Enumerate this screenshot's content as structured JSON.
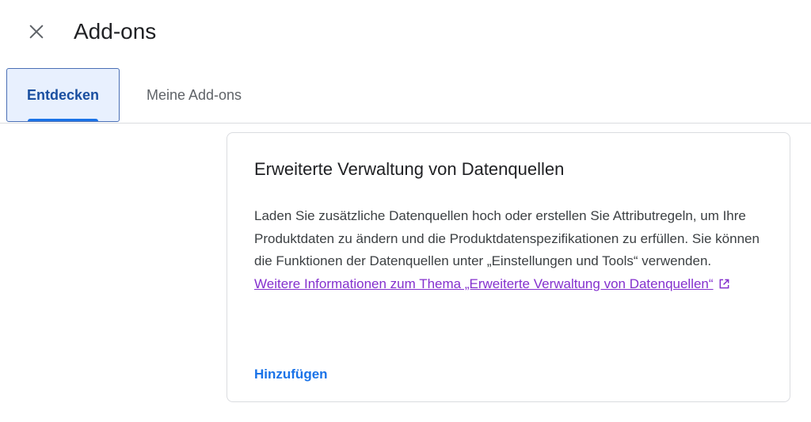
{
  "header": {
    "title": "Add-ons",
    "close_icon": "close-icon"
  },
  "tabs": [
    {
      "label": "Entdecken",
      "selected": true
    },
    {
      "label": "Meine Add-ons",
      "selected": false
    }
  ],
  "card": {
    "title": "Erweiterte Verwaltung von Datenquellen",
    "description": "Laden Sie zusätzliche Datenquellen hoch oder erstellen Sie Attributregeln, um Ihre Produktdaten zu ändern und die Produktdatenspezifikationen zu erfüllen. Sie können die Funktionen der Datenquellen unter „Einstellungen und Tools“ verwenden. ",
    "link_text": "Weitere Informationen zum Thema „Erweiterte Verwaltung von Datenquellen“",
    "link_icon": "open-in-new-icon",
    "action_label": "Hinzufügen"
  },
  "colors": {
    "accent": "#1a73e8",
    "link_visited": "#8430ce",
    "selected_tab_bg": "#e8f0fe"
  }
}
